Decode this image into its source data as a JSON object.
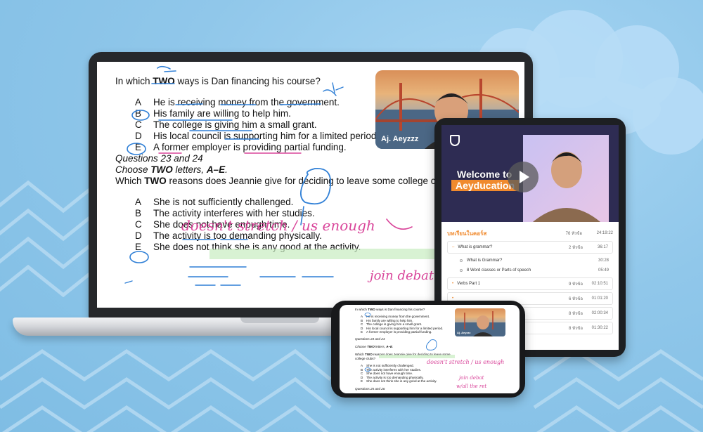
{
  "colors": {
    "background": "#8fc6ea",
    "device_frame": "#26282b",
    "course_hero": "#2e2c53",
    "accent": "#f08a2e",
    "ink_blue": "#2f7fd6",
    "ink_pink": "#d9459a",
    "highlight_green": "#c8ecc0"
  },
  "worksheet": {
    "question1": {
      "pre": "In which ",
      "bold": "TWO",
      "post": " ways is Dan financing his course?",
      "options": [
        {
          "letter": "A",
          "text": "He is receiving money from the government."
        },
        {
          "letter": "B",
          "text": "His family are willing to help him."
        },
        {
          "letter": "C",
          "text": "The college is giving him a small grant."
        },
        {
          "letter": "D",
          "text": "His local council is supporting him for a limited period."
        },
        {
          "letter": "E",
          "text": "A former employer is providing partial funding."
        }
      ]
    },
    "section_heading": "Questions 23 and 24",
    "instruction": {
      "pre": "Choose ",
      "bold": "TWO",
      "mid": " letters, ",
      "bold2": "A–E",
      "post": "."
    },
    "question2": {
      "pre": "Which ",
      "bold": "TWO",
      "post": " reasons does Jeannie give for deciding to leave some college clubs?",
      "options": [
        {
          "letter": "A",
          "text": "She is not sufficiently challenged."
        },
        {
          "letter": "B",
          "text": "The activity interferes with her studies."
        },
        {
          "letter": "C",
          "text": "She does not have enough time."
        },
        {
          "letter": "D",
          "text": "The activity is too demanding physically."
        },
        {
          "letter": "E",
          "text": "She does not think she is any good at the activity."
        }
      ]
    },
    "handwriting": {
      "note1": "doesn't stretch / us enough",
      "note2": "join debat"
    },
    "presenter_name": "Aj. Aeyzzz"
  },
  "course": {
    "hero_line1": "Welcome to",
    "hero_line2": "Aeyducation",
    "curriculum_title": "บทเรียนในคอร์ส",
    "curriculum_count": "76 หัวข้อ",
    "curriculum_duration": "24:19:22",
    "sections": [
      {
        "name": "What is grammar?",
        "count": "2 หัวข้อ",
        "duration": "36:17",
        "expanded": true,
        "lessons": [
          {
            "name": "What is Grammar?",
            "duration": "30:28"
          },
          {
            "name": "8 Word classes or Parts of speech",
            "duration": "05:49"
          }
        ]
      },
      {
        "name": "Verbs Part 1",
        "count": "9 หัวข้อ",
        "duration": "02:10:51"
      },
      {
        "name": "",
        "count": "6 หัวข้อ",
        "duration": "01:01:20"
      },
      {
        "name": "",
        "count": "8 หัวข้อ",
        "duration": "02:00:34"
      },
      {
        "name": "",
        "count": "8 หัวข้อ",
        "duration": "01:30:22"
      }
    ]
  },
  "phone": {
    "extra_note": "w/all the ret",
    "footer_heading": "Questions 25 and 26"
  }
}
